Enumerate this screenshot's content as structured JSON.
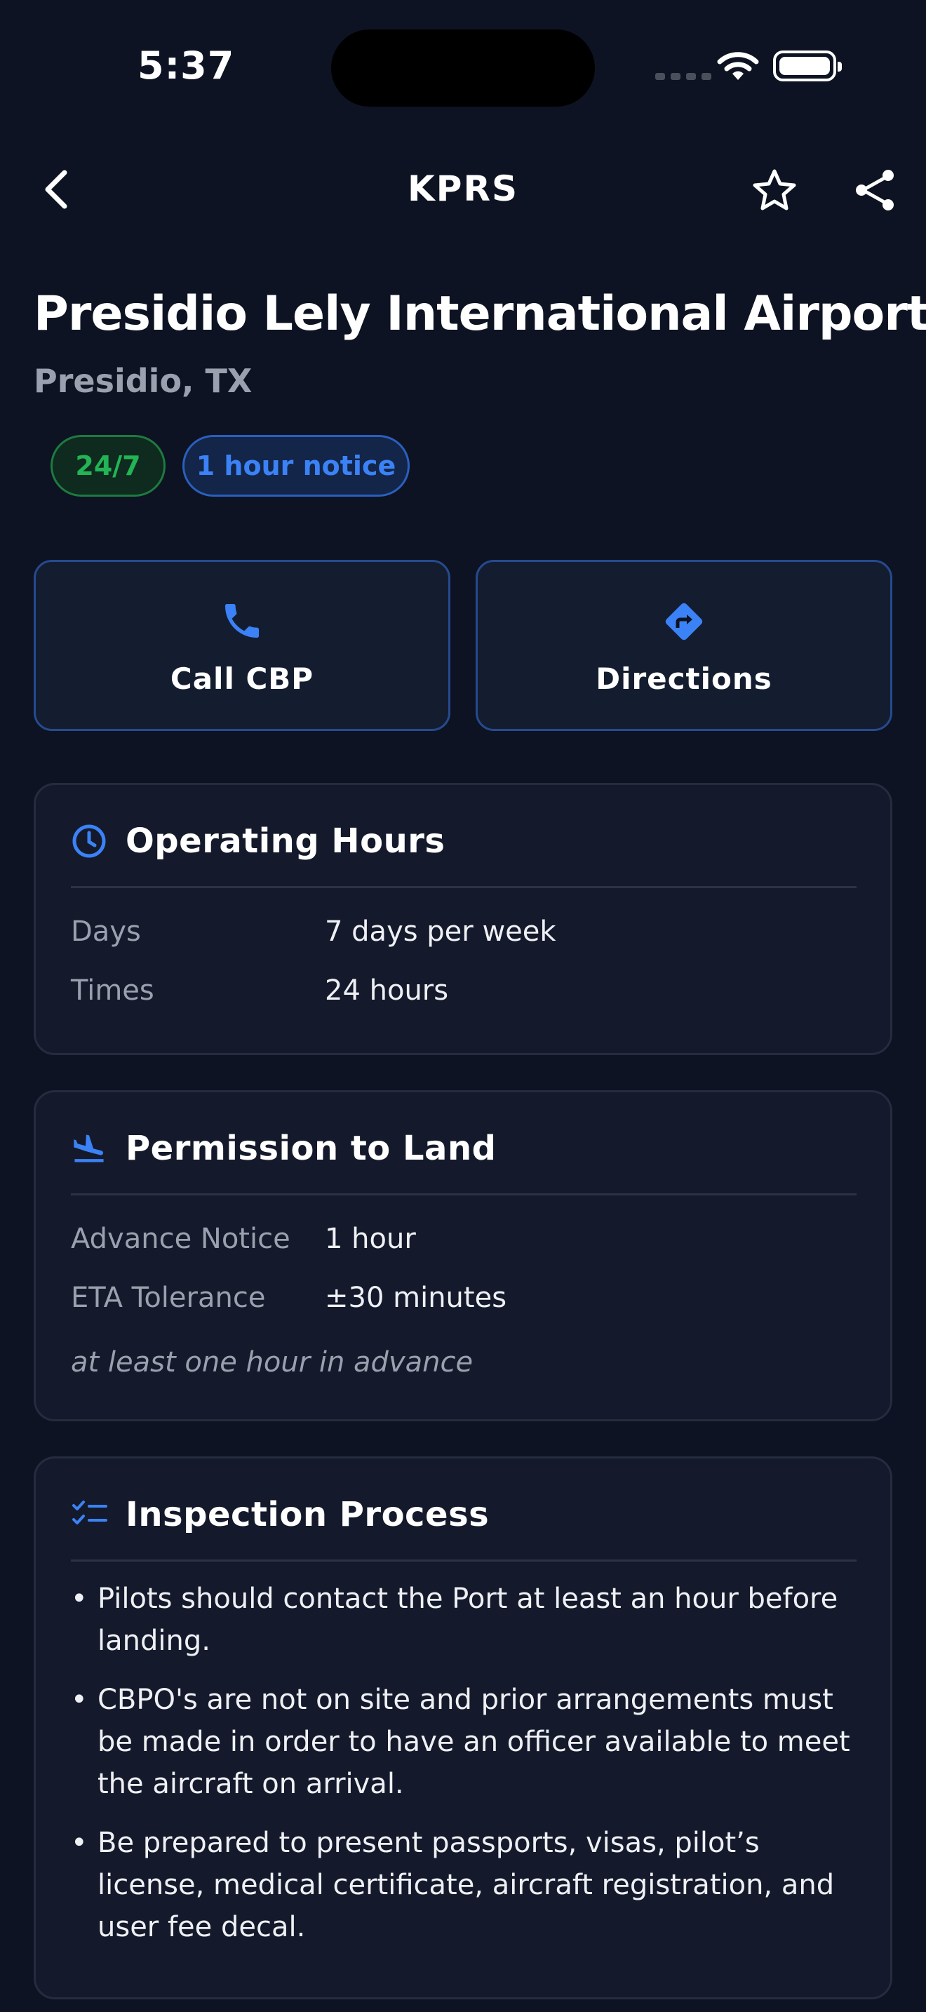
{
  "status": {
    "time": "5:37"
  },
  "nav": {
    "title": "KPRS"
  },
  "airport": {
    "name": "Presidio Lely International Airport",
    "location": "Presidio, TX"
  },
  "badges": [
    {
      "label": "24/7",
      "color": "#22b455"
    },
    {
      "label": "1 hour notice",
      "color": "#3b82f6"
    }
  ],
  "actions": {
    "call": {
      "label": "Call CBP",
      "icon": "phone-icon"
    },
    "directions": {
      "label": "Directions",
      "icon": "directions-icon"
    }
  },
  "operating_hours": {
    "title": "Operating Hours",
    "rows": [
      {
        "key": "Days",
        "value": "7 days per week"
      },
      {
        "key": "Times",
        "value": "24 hours"
      }
    ]
  },
  "permission": {
    "title": "Permission to Land",
    "rows": [
      {
        "key": "Advance Notice",
        "value": "1 hour"
      },
      {
        "key": "ETA Tolerance",
        "value": "±30 minutes"
      }
    ],
    "note": "at least one hour in advance"
  },
  "inspection": {
    "title": "Inspection Process",
    "items": [
      "Pilots should contact the Port at least an hour before landing.",
      "CBPO's are not on site and prior arrangements must be made in order to have an officer available to meet the aircraft on arrival.",
      "Be prepared to present passports, visas, pilot’s license, medical certificate, aircraft registration, and user fee decal."
    ]
  },
  "colors": {
    "accent": "#3b82f6",
    "background": "#0d1322",
    "card": "#141a2b"
  }
}
